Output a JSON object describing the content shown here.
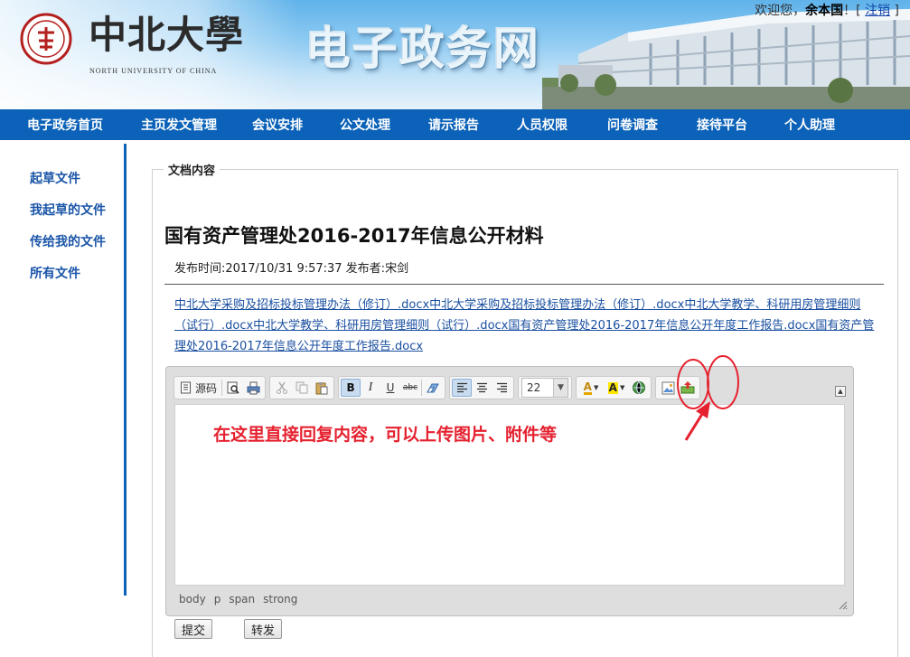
{
  "header": {
    "logo_cn": "中北大學",
    "logo_en": "NORTH UNIVERSITY OF CHINA",
    "site_title": "电子政务网",
    "welcome_prefix": "欢迎您，",
    "username": "余本国",
    "welcome_mid": "！[",
    "logout": "注销",
    "welcome_suffix": "]"
  },
  "nav": {
    "items": [
      "电子政务首页",
      "主页发文管理",
      "会议安排",
      "公文处理",
      "请示报告",
      "人员权限",
      "问卷调查",
      "接待平台",
      "个人助理"
    ]
  },
  "sidebar": {
    "items": [
      "起草文件",
      "我起草的文件",
      "传给我的文件",
      "所有文件"
    ]
  },
  "main": {
    "legend": "文档内容",
    "title": "国有资产管理处2016-2017年信息公开材料",
    "meta": "发布时间:2017/10/31 9:57:37 发布者:宋剑",
    "attachments": "中北大学采购及招标投标管理办法（修订）.docx中北大学采购及招标投标管理办法（修订）.docx中北大学教学、科研用房管理细则（试行）.docx中北大学教学、科研用房管理细则（试行）.docx国有资产管理处2016-2017年信息公开年度工作报告.docx国有资产管理处2016-2017年信息公开年度工作报告.docx"
  },
  "editor": {
    "source_label": "源码",
    "font_size": "22",
    "bold": "B",
    "italic": "I",
    "underline": "U",
    "strike": "abc",
    "font_color": "A",
    "bg_color": "A",
    "hint": "在这里直接回复内容，可以上传图片、附件等",
    "path": [
      "body",
      "p",
      "span",
      "strong"
    ],
    "annotation_color": "#e5212f"
  },
  "actions": {
    "submit": "提交",
    "forward": "转发"
  }
}
